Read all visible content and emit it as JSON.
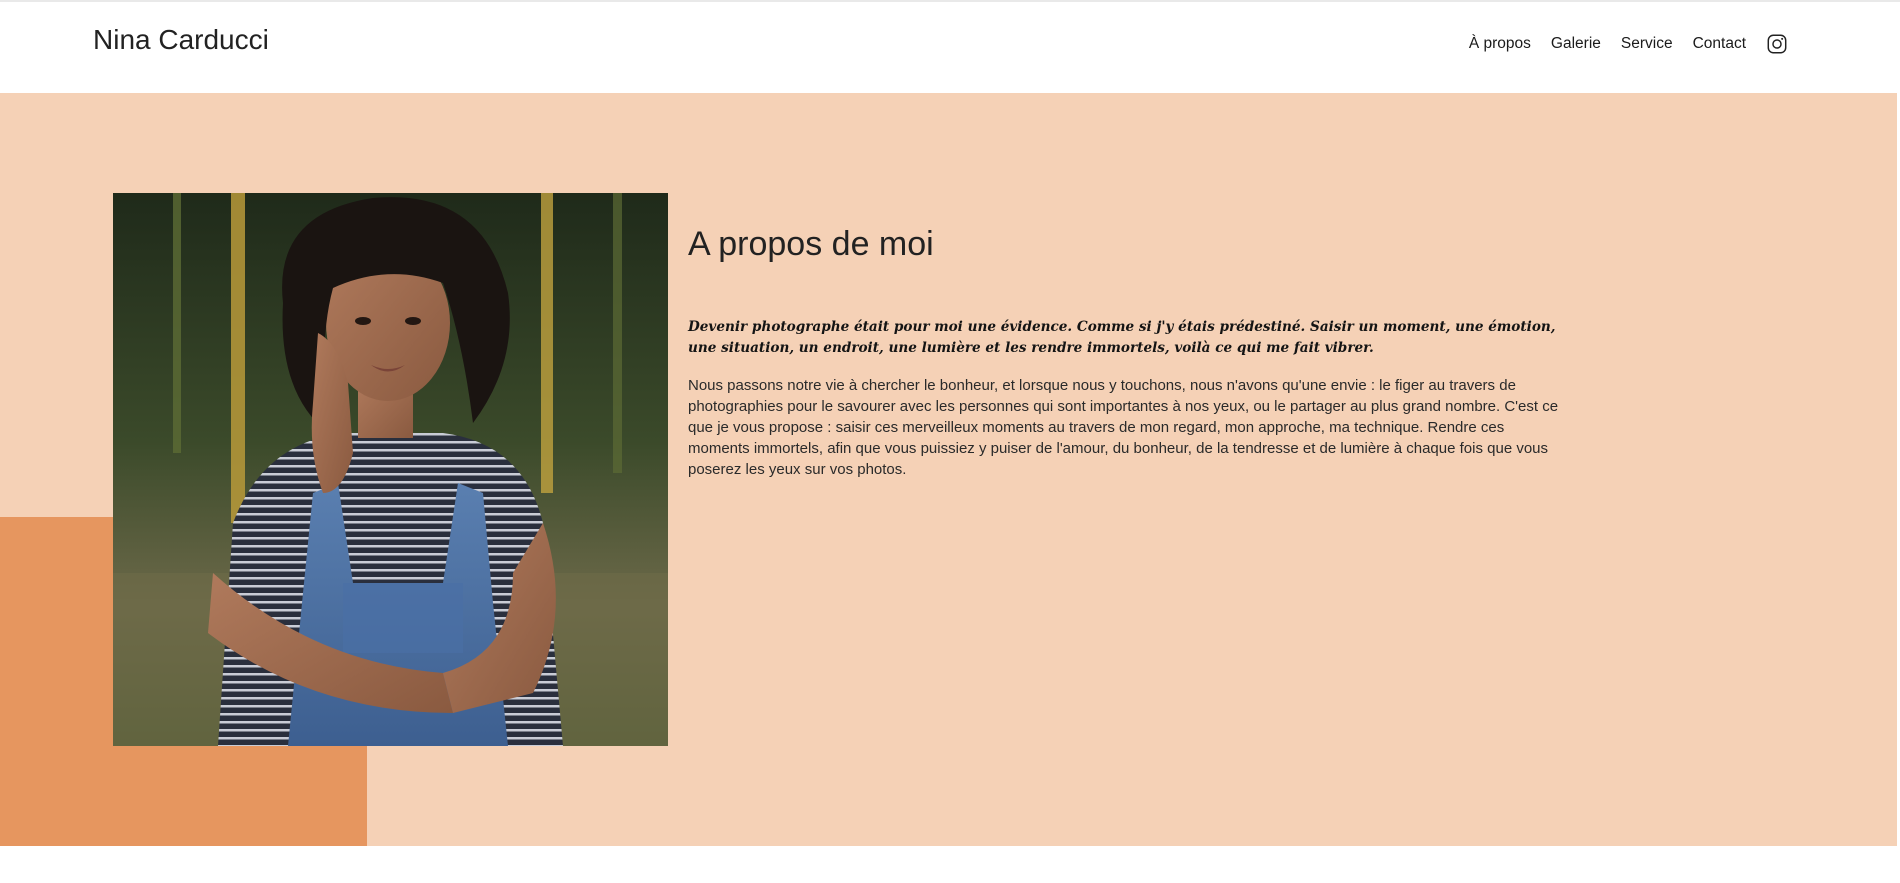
{
  "header": {
    "site_title": "Nina Carducci",
    "nav": [
      {
        "label": "À propos"
      },
      {
        "label": "Galerie"
      },
      {
        "label": "Service"
      },
      {
        "label": "Contact"
      }
    ],
    "social_icon": "instagram-icon"
  },
  "about": {
    "title": "A propos de moi",
    "lead": "Devenir photographe était pour moi une évidence. Comme si j'y étais prédestiné. Saisir un moment, une émotion, une situation, un endroit, une lumière et les rendre immortels, voilà ce qui me fait vibrer.",
    "body": "Nous passons notre vie à chercher le bonheur, et lorsque nous y touchons, nous n'avons qu'une envie : le figer au travers de photographies pour le savourer avec les personnes qui sont importantes à nos yeux, ou le partager au plus grand nombre. C'est ce que je vous propose : saisir ces merveilleux moments au travers de mon regard, mon approche, ma technique. Rendre ces moments immortels, afin que vous puissiez y puiser de l'amour, du bonheur, de la tendresse et de lumière à chaque fois que vous poserez les yeux sur vos photos."
  },
  "colors": {
    "hero_background": "#f5d1b6",
    "accent_block": "#e6965f",
    "text": "#222222"
  }
}
